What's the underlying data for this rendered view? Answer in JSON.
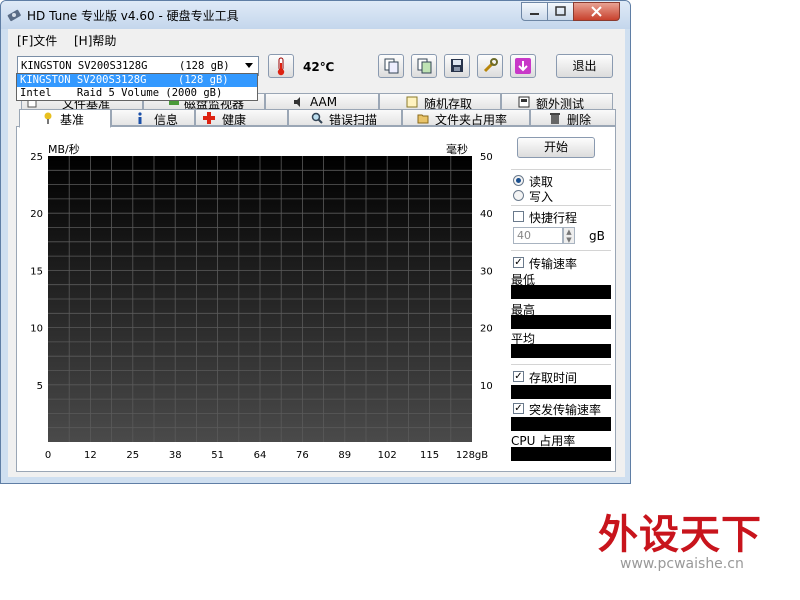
{
  "window": {
    "title": "HD Tune 专业版 v4.60 - 硬盘专业工具"
  },
  "menu": {
    "file": "[F]文件",
    "help": "[H]帮助"
  },
  "toolbar": {
    "drive_selected": "KINGSTON SV200S3128G     (128 gB)",
    "drive_options": [
      "KINGSTON SV200S3128G     (128 gB)",
      "Intel    Raid 5 Volume (2000 gB)"
    ],
    "temperature": "42℃",
    "exit_label": "退出"
  },
  "tabs_row1": [
    {
      "label": "文件基准",
      "icon": "document-icon"
    },
    {
      "label": "磁盘监视器",
      "icon": "monitor-icon"
    },
    {
      "label": "AAM",
      "icon": "speaker-icon"
    },
    {
      "label": "随机存取",
      "icon": "random-icon"
    },
    {
      "label": "额外测试",
      "icon": "extra-icon"
    }
  ],
  "tabs_row2": [
    {
      "label": "基准",
      "icon": "benchmark-icon",
      "active": true
    },
    {
      "label": "信息",
      "icon": "info-icon"
    },
    {
      "label": "健康",
      "icon": "health-cross-icon"
    },
    {
      "label": "错误扫描",
      "icon": "magnifier-icon"
    },
    {
      "label": "文件夹占用率",
      "icon": "folder-icon"
    },
    {
      "label": "删除",
      "icon": "trash-icon"
    }
  ],
  "chart_data": {
    "type": "line",
    "title": "",
    "ylabel_left": "MB/秒",
    "ylabel_right": "毫秒",
    "y_left_ticks": [
      "25",
      "20",
      "15",
      "10",
      "5"
    ],
    "y_right_ticks": [
      "50",
      "40",
      "30",
      "20",
      "10"
    ],
    "x_ticks": [
      "0",
      "12",
      "25",
      "38",
      "51",
      "64",
      "76",
      "89",
      "102",
      "115",
      "128gB"
    ],
    "ylim_left": [
      0,
      25
    ],
    "ylim_right": [
      0,
      50
    ],
    "xlim": [
      0,
      128
    ],
    "series": [],
    "grid": true
  },
  "side": {
    "start_label": "开始",
    "read_label": "读取",
    "write_label": "写入",
    "quick_label": "快捷行程",
    "quick_value": "40",
    "quick_unit": "gB",
    "transfer_label": "传输速率",
    "min_label": "最低",
    "max_label": "最高",
    "avg_label": "平均",
    "access_label": "存取时间",
    "burst_label": "突发传输速率",
    "cpu_label": "CPU 占用率"
  },
  "watermark": {
    "main": "外设天下",
    "url": "www.pcwaishe.cn"
  }
}
